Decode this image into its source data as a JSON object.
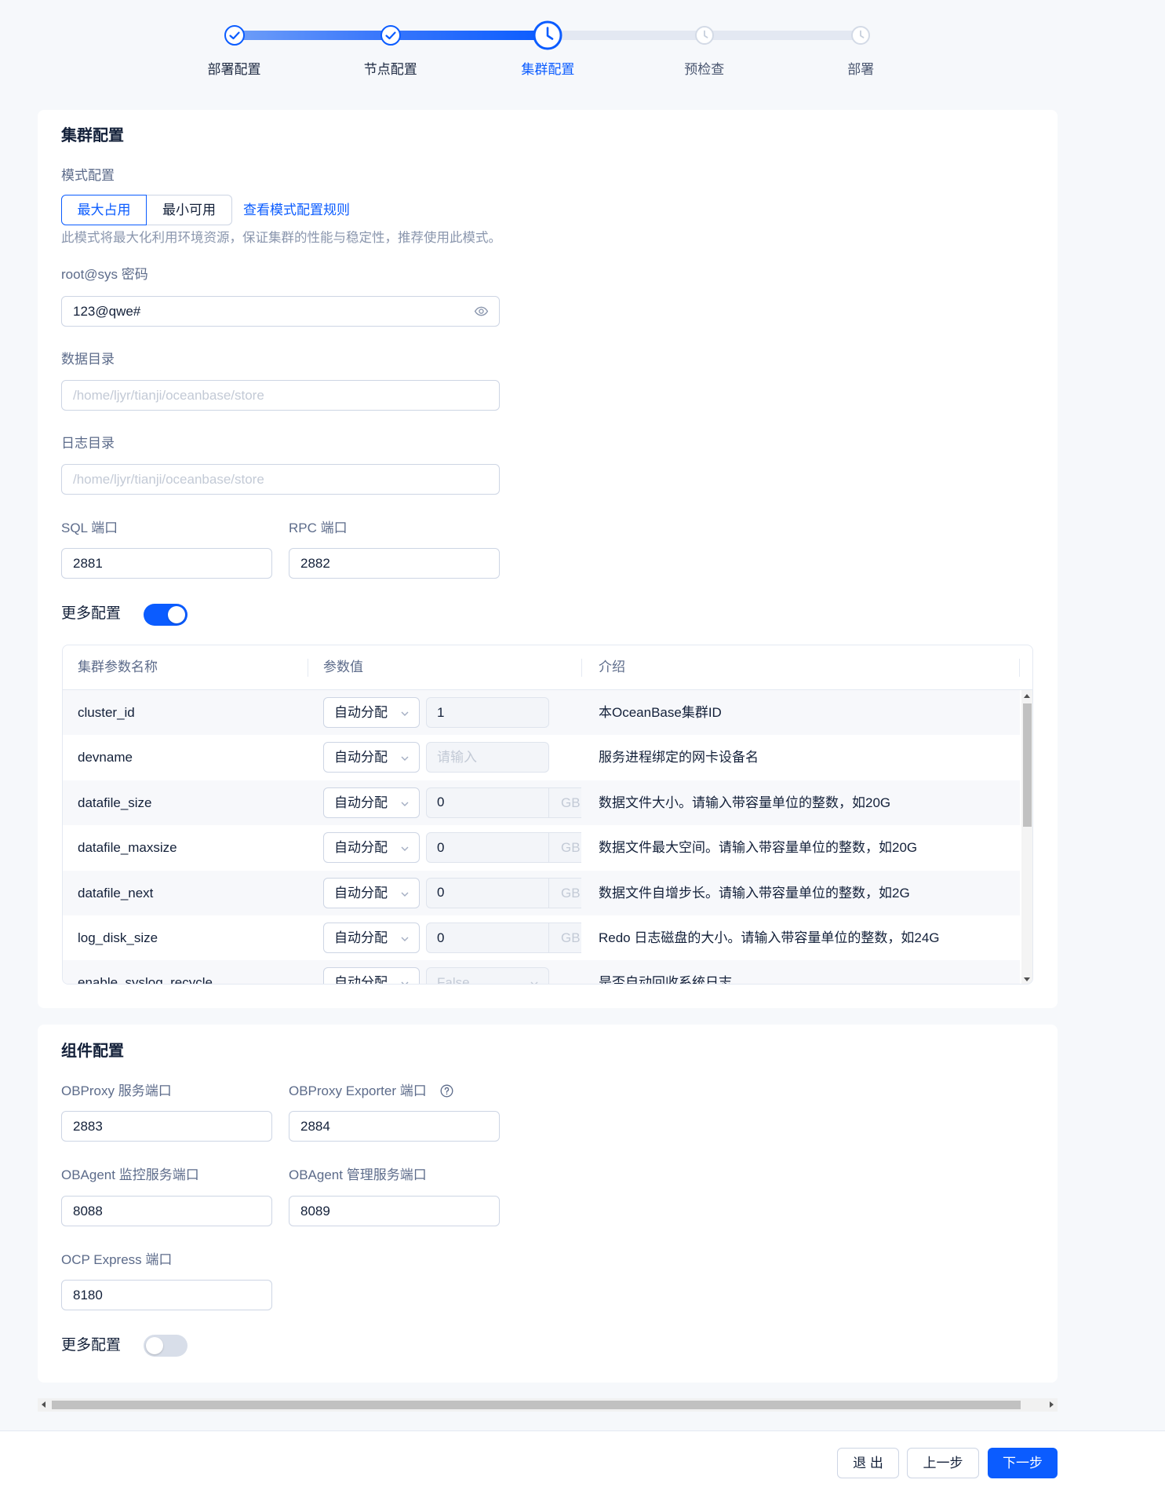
{
  "steps": [
    {
      "label": "部署配置",
      "icon": "check-icon"
    },
    {
      "label": "节点配置",
      "icon": "check-icon"
    },
    {
      "label": "集群配置",
      "icon": "clock-icon",
      "active": true
    },
    {
      "label": "预检查",
      "icon": "clock-icon"
    },
    {
      "label": "部署",
      "icon": "clock-icon"
    }
  ],
  "cluster": {
    "title": "集群配置",
    "mode": {
      "label": "模式配置",
      "options": [
        "最大占用",
        "最小可用"
      ],
      "selected_index": 0,
      "rules_link": "查看模式配置规则",
      "description": "此模式将最大化利用环境资源，保证集群的性能与稳定性，推荐使用此模式。"
    },
    "password": {
      "label": "root@sys 密码",
      "value": "123@qwe#",
      "icon": "eye-icon"
    },
    "data_dir": {
      "label": "数据目录",
      "placeholder": "/home/ljyr/tianji/oceanbase/store"
    },
    "log_dir": {
      "label": "日志目录",
      "placeholder": "/home/ljyr/tianji/oceanbase/store"
    },
    "sql_port": {
      "label": "SQL 端口",
      "value": "2881"
    },
    "rpc_port": {
      "label": "RPC 端口",
      "value": "2882"
    },
    "more": {
      "label": "更多配置",
      "enabled": true
    }
  },
  "params": {
    "columns": [
      "集群参数名称",
      "参数值",
      "介绍"
    ],
    "rows": [
      {
        "name": "cluster_id",
        "mode": "自动分配",
        "value": "1",
        "intro": "本OceanBase集群ID"
      },
      {
        "name": "devname",
        "mode": "自动分配",
        "placeholder": "请输入",
        "intro": "服务进程绑定的网卡设备名"
      },
      {
        "name": "datafile_size",
        "mode": "自动分配",
        "value": "0",
        "unit": "GB",
        "intro": "数据文件大小。请输入带容量单位的整数，如20G"
      },
      {
        "name": "datafile_maxsize",
        "mode": "自动分配",
        "value": "0",
        "unit": "GB",
        "intro": "数据文件最大空间。请输入带容量单位的整数，如20G"
      },
      {
        "name": "datafile_next",
        "mode": "自动分配",
        "value": "0",
        "unit": "GB",
        "intro": "数据文件自增步长。请输入带容量单位的整数，如2G"
      },
      {
        "name": "log_disk_size",
        "mode": "自动分配",
        "value": "0",
        "unit": "GB",
        "intro": "Redo 日志磁盘的大小。请输入带容量单位的整数，如24G"
      },
      {
        "name": "enable_syslog_recycle",
        "mode": "自动分配",
        "value": "False",
        "intro": "是否自动回收系统日志"
      }
    ]
  },
  "components": {
    "title": "组件配置",
    "obproxy_port": {
      "label": "OBProxy 服务端口",
      "value": "2883"
    },
    "obproxy_exporter_port": {
      "label": "OBProxy Exporter 端口",
      "value": "2884",
      "icon": "question-circle-icon"
    },
    "obagent_monitor_port": {
      "label": "OBAgent 监控服务端口",
      "value": "8088"
    },
    "obagent_manage_port": {
      "label": "OBAgent 管理服务端口",
      "value": "8089"
    },
    "ocp_express_port": {
      "label": "OCP Express 端口",
      "value": "8180"
    },
    "more": {
      "label": "更多配置",
      "enabled": false
    }
  },
  "footer": {
    "exit": "退 出",
    "prev": "上一步",
    "next": "下一步"
  },
  "colors": {
    "primary": "#0b5cff",
    "label": "#5c6b8a",
    "text": "#132039",
    "border": "#cdd5e4",
    "background": "#f6f8fb"
  }
}
